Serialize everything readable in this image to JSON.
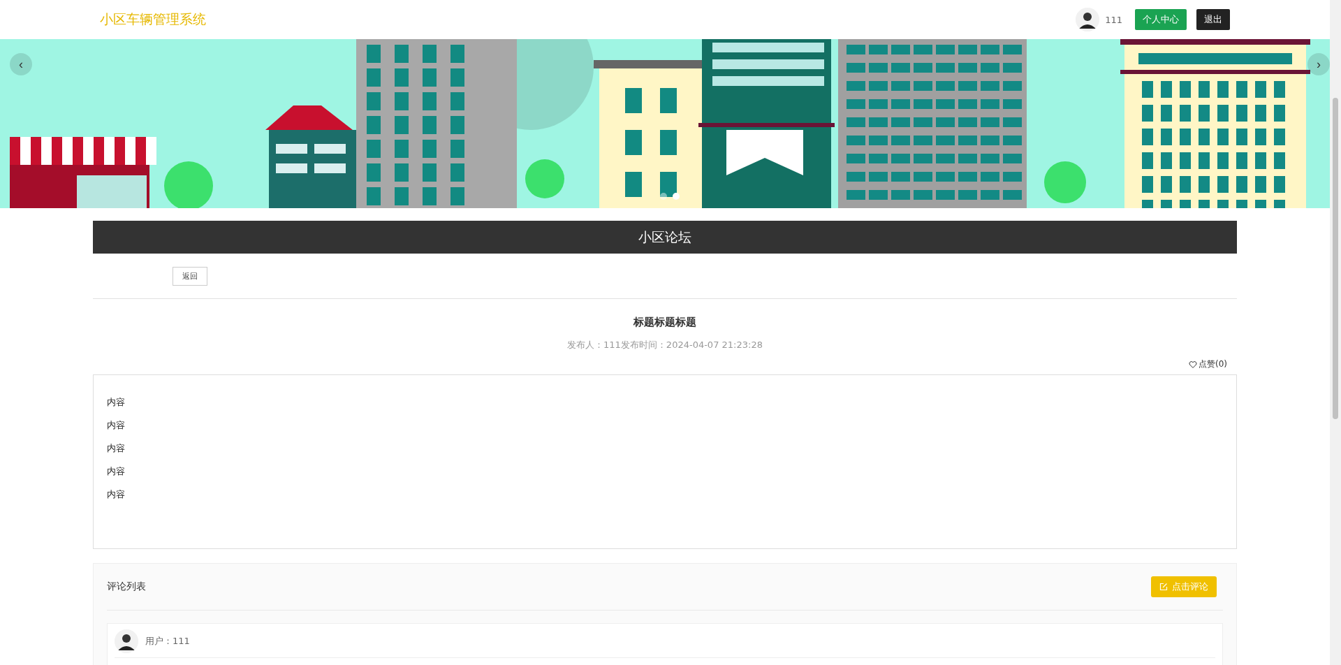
{
  "header": {
    "site_title": "小区车辆管理系统",
    "username": "111",
    "buttons": [
      {
        "label": "个人中心",
        "kind": "primary"
      },
      {
        "label": "退出",
        "kind": "dark"
      }
    ]
  },
  "banner": {
    "prev": "‹",
    "next": "›",
    "dots": [
      {
        "selected": false
      },
      {
        "selected": true
      }
    ]
  },
  "section_title": "小区论坛",
  "back_button": "返回",
  "post": {
    "title": "标题标题标题",
    "meta": "发布人：111发布时间：2024-04-07 21:23:28",
    "like": "点赞(0)",
    "liked": false,
    "content": [
      "内容",
      "内容",
      "内容",
      "内容",
      "内容"
    ]
  },
  "comments": {
    "heading": "评论列表",
    "add_button": "点击评论",
    "items": [
      {
        "user": "用户：111"
      }
    ]
  }
}
